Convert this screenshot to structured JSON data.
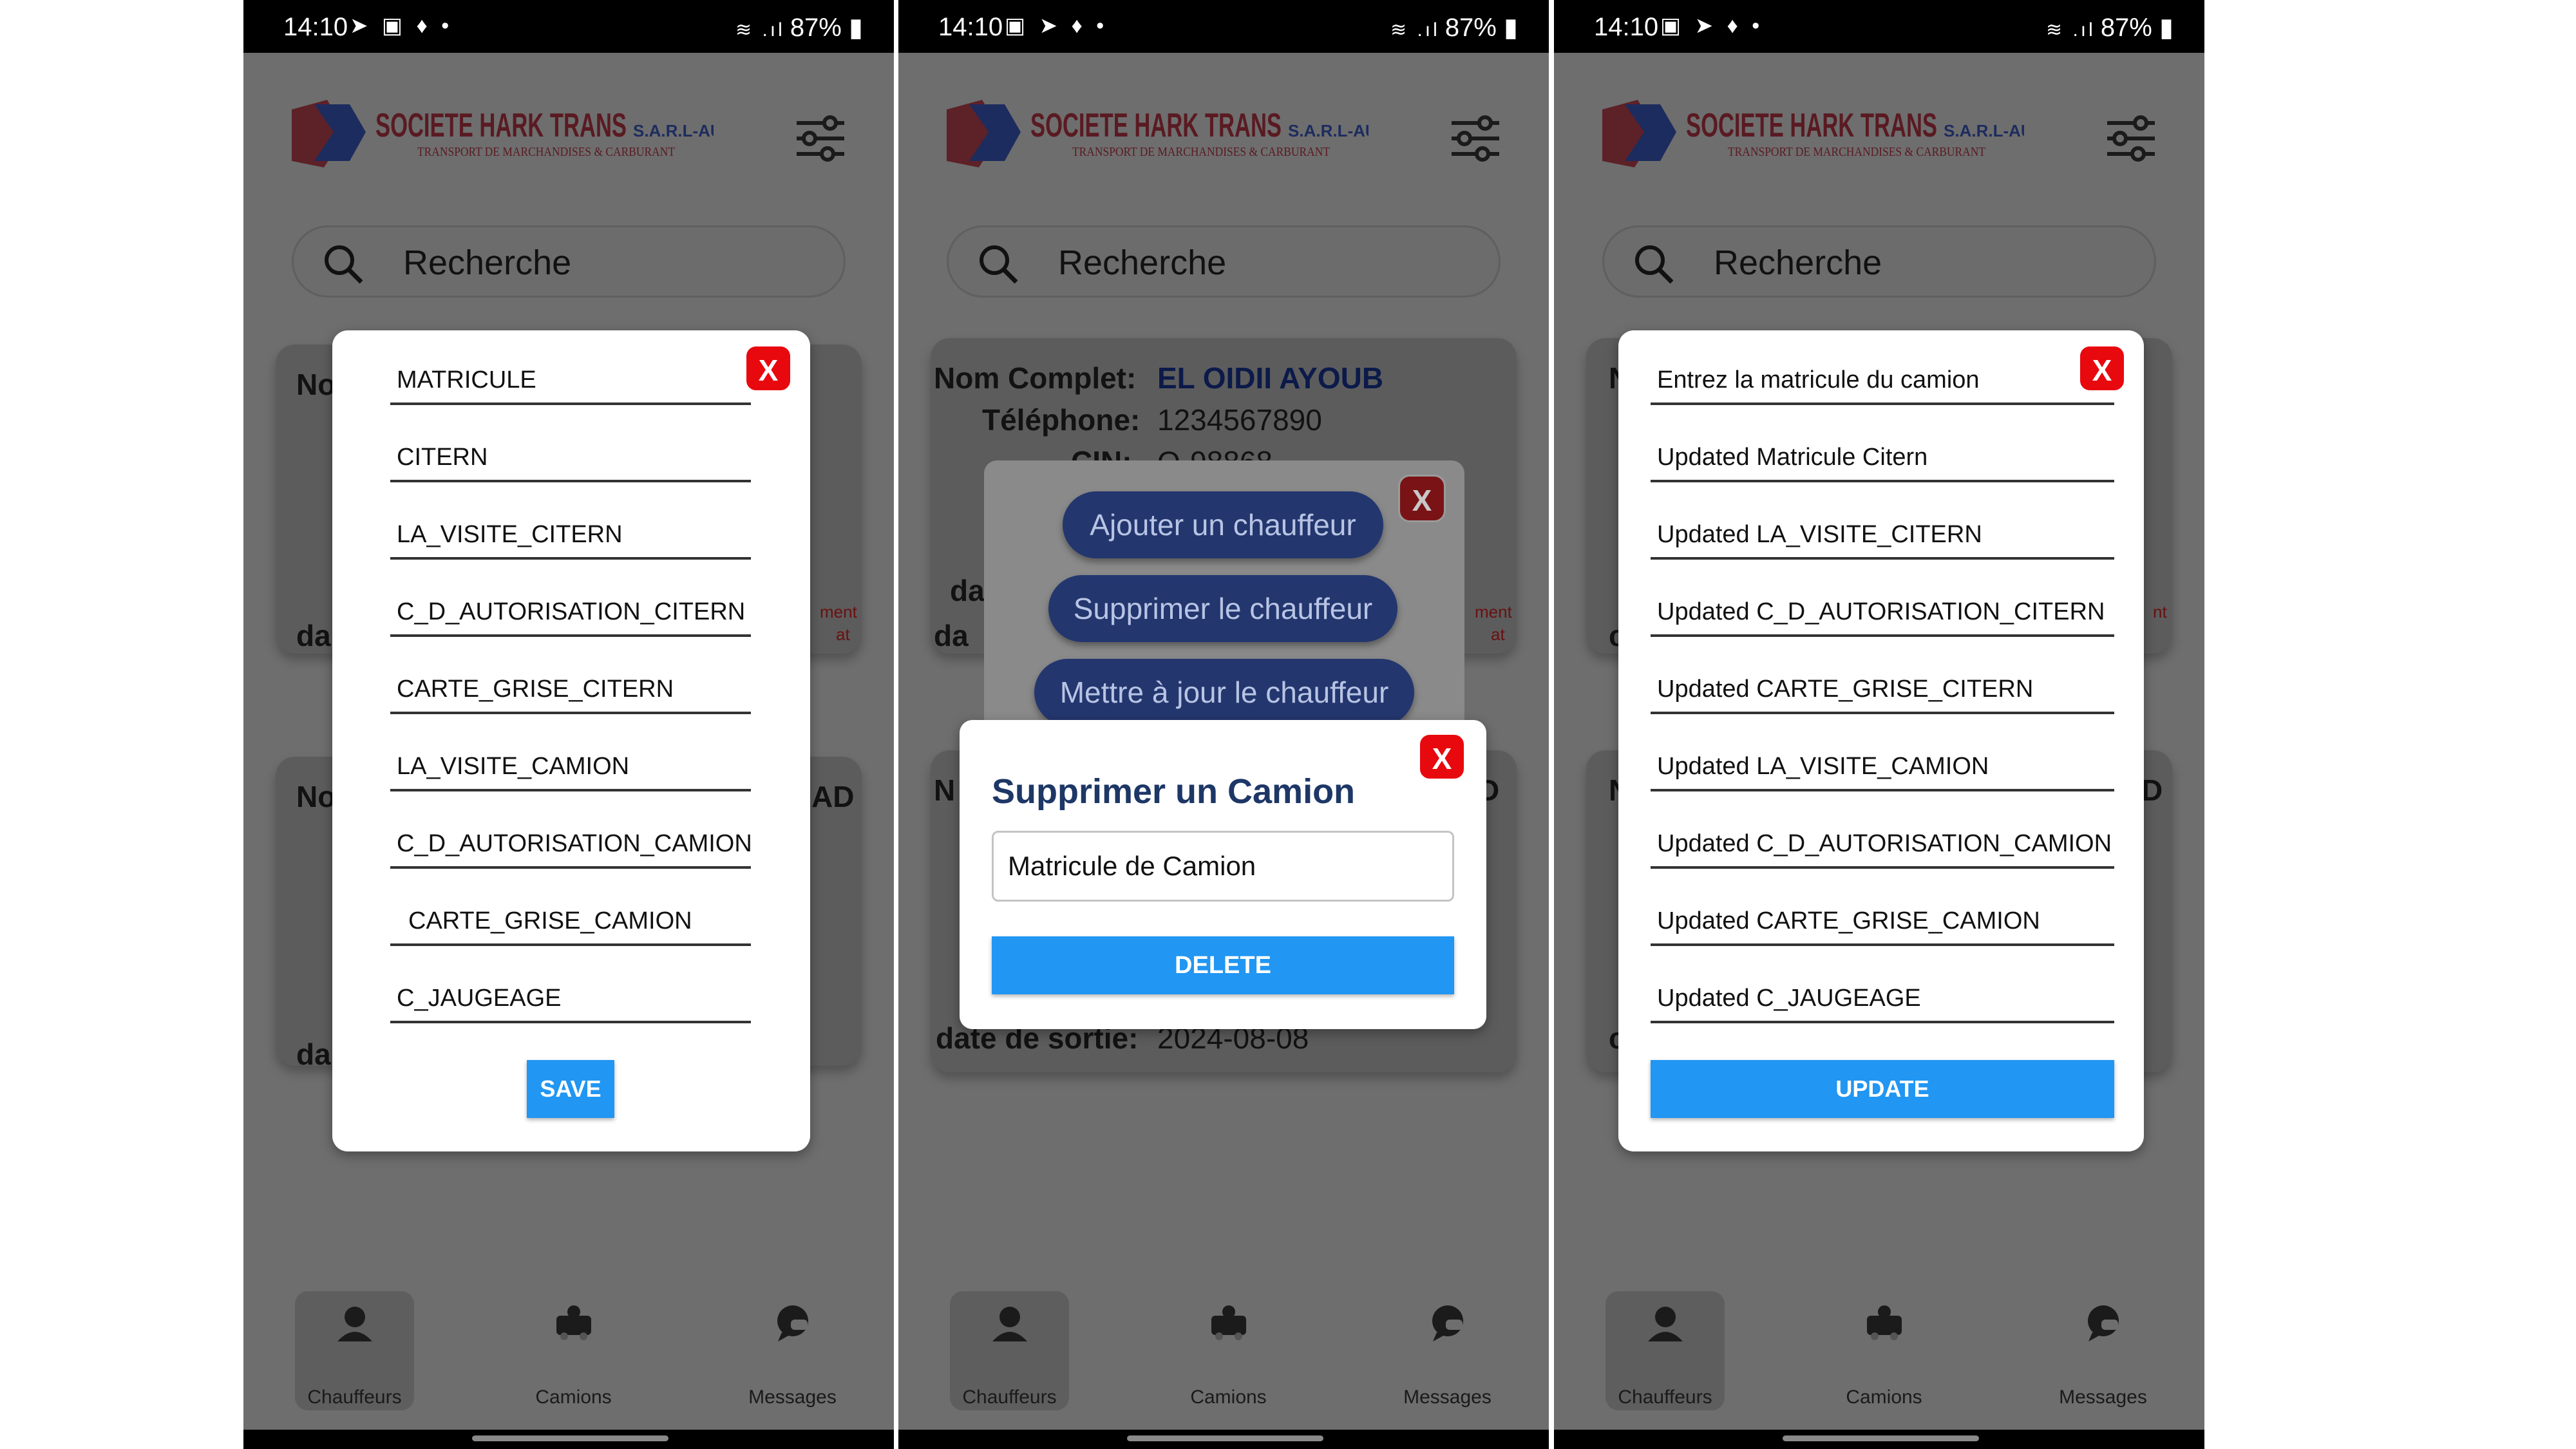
{
  "status": {
    "time": "14:10",
    "battery": "87%"
  },
  "app": {
    "brand": "SOCIETE HARK TRANS",
    "brand_suffix": "S.A.R.L-AU",
    "tagline": "TRANSPORT DE MARCHANDISES & CARBURANT"
  },
  "search": {
    "placeholder": "Recherche"
  },
  "nav": {
    "chauffeurs": "Chauffeurs",
    "camions": "Camions",
    "messages": "Messages"
  },
  "screen1": {
    "fields": [
      "MATRICULE",
      "CITERN",
      "LA_VISITE_CITERN",
      "C_D_AUTORISATION_CITERN",
      "CARTE_GRISE_CITERN",
      "LA_VISITE_CAMION",
      "C_D_AUTORISATION_CAMION",
      "CARTE_GRISE_CAMION",
      "C_JAUGEAGE"
    ],
    "close": "X",
    "save": "SAVE",
    "bg_text": {
      "a": "No",
      "b": "da",
      "c": "da",
      "d": "No",
      "e": "AD",
      "f": "da",
      "g": "da",
      "h": "ment",
      "i": "at"
    }
  },
  "screen2": {
    "card1": {
      "name_label": "Nom Complet:",
      "name_value": "EL OIDII AYOUB",
      "phone_label": "Téléphone:",
      "phone_value": "1234567890",
      "cin_label": "CIN:",
      "cin_value": "Q-98868",
      "da1": "da",
      "da2": "da",
      "ment": "ment",
      "at": "at"
    },
    "card2": {
      "n": "N",
      "d": "D",
      "date_label": "date de sortie:",
      "date_value": "2024-08-08"
    },
    "menu": {
      "add": "Ajouter un chauffeur",
      "delete": "Supprimer le chauffeur",
      "update": "Mettre à jour le chauffeur",
      "close": "X"
    },
    "dialog": {
      "title": "Supprimer un Camion",
      "input_value": "Matricule de Camion",
      "button": "DELETE",
      "close": "X"
    }
  },
  "screen3": {
    "fields": [
      "Entrez la matricule du camion",
      "Updated Matricule Citern",
      "Updated LA_VISITE_CITERN",
      "Updated C_D_AUTORISATION_CITERN",
      "Updated CARTE_GRISE_CITERN",
      "Updated LA_VISITE_CAMION",
      "Updated C_D_AUTORISATION_CAMION",
      "Updated CARTE_GRISE_CAMION",
      "Updated C_JAUGEAGE"
    ],
    "close": "X",
    "update": "UPDATE",
    "bg_text": {
      "a": "N",
      "b": "c",
      "c": "N",
      "d": "D",
      "e": "c",
      "f": "nt"
    }
  },
  "colors": {
    "accent_blue": "#2196f3",
    "close_red": "#e8090f",
    "pill_navy": "#23366e",
    "overlay_gray": "#6e6e6e"
  }
}
